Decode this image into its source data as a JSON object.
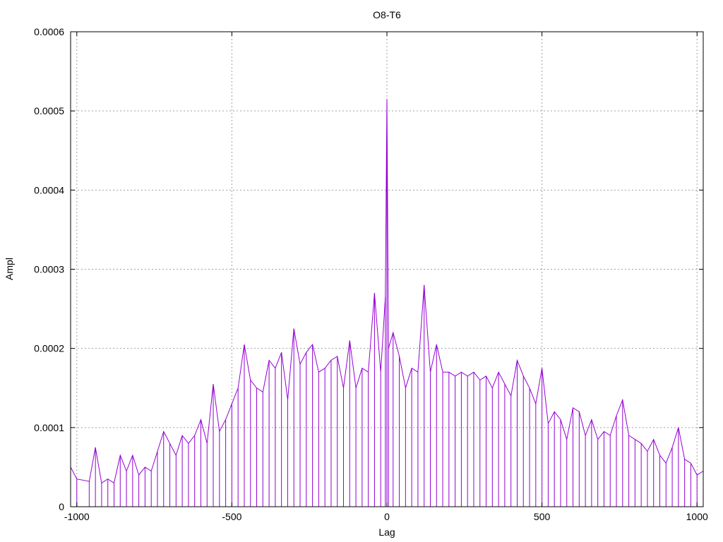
{
  "chart_data": {
    "type": "line",
    "title": "O8-T6",
    "xlabel": "Lag",
    "ylabel": "Ampl",
    "xlim": [
      -1020,
      1020
    ],
    "ylim": [
      0,
      0.0006
    ],
    "xticks": [
      -1000,
      -500,
      0,
      500,
      1000
    ],
    "xtick_labels": [
      "-1000",
      "-500",
      "0",
      "500",
      "1000"
    ],
    "yticks": [
      0,
      0.0001,
      0.0002,
      0.0003,
      0.0004,
      0.0005,
      0.0006
    ],
    "ytick_labels": [
      "0",
      "0.0001",
      "0.0002",
      "0.0003",
      "0.0004",
      "0.0005",
      "0.0006"
    ],
    "grid": true,
    "legend": "none",
    "series": [
      {
        "color": "#9400d3",
        "x": [
          -1020,
          -1000,
          -960,
          -940,
          -920,
          -900,
          -880,
          -860,
          -840,
          -820,
          -800,
          -780,
          -760,
          -740,
          -720,
          -700,
          -680,
          -660,
          -640,
          -620,
          -600,
          -580,
          -560,
          -540,
          -520,
          -500,
          -480,
          -460,
          -440,
          -420,
          -400,
          -380,
          -360,
          -340,
          -320,
          -300,
          -280,
          -260,
          -240,
          -220,
          -200,
          -180,
          -160,
          -140,
          -120,
          -100,
          -80,
          -60,
          -40,
          -20,
          -5,
          0,
          5,
          20,
          40,
          60,
          80,
          100,
          120,
          140,
          160,
          180,
          200,
          220,
          240,
          260,
          280,
          300,
          320,
          340,
          360,
          380,
          400,
          420,
          440,
          460,
          480,
          500,
          520,
          540,
          560,
          580,
          600,
          620,
          640,
          660,
          680,
          700,
          720,
          740,
          760,
          780,
          800,
          820,
          840,
          860,
          880,
          900,
          920,
          940,
          960,
          980,
          1000,
          1020
        ],
        "values": [
          5e-05,
          3.5e-05,
          3.2e-05,
          7.5e-05,
          3e-05,
          3.5e-05,
          3e-05,
          6.5e-05,
          4.5e-05,
          6.5e-05,
          4e-05,
          5e-05,
          4.5e-05,
          7e-05,
          9.5e-05,
          8e-05,
          6.5e-05,
          9e-05,
          8e-05,
          9e-05,
          0.00011,
          8e-05,
          0.000155,
          9.5e-05,
          0.00011,
          0.00013,
          0.00015,
          0.000205,
          0.00016,
          0.00015,
          0.000145,
          0.000185,
          0.000175,
          0.000195,
          0.000135,
          0.000225,
          0.00018,
          0.000195,
          0.000205,
          0.00017,
          0.000175,
          0.000185,
          0.00019,
          0.00015,
          0.00021,
          0.00015,
          0.000175,
          0.00017,
          0.00027,
          0.00017,
          0.000265,
          0.000515,
          0.0002,
          0.00022,
          0.00019,
          0.00015,
          0.000175,
          0.00017,
          0.00028,
          0.00017,
          0.000205,
          0.00017,
          0.00017,
          0.000165,
          0.00017,
          0.000165,
          0.00017,
          0.00016,
          0.000165,
          0.00015,
          0.00017,
          0.000155,
          0.00014,
          0.000185,
          0.000165,
          0.00015,
          0.00013,
          0.000175,
          0.000105,
          0.00012,
          0.00011,
          8.5e-05,
          0.000125,
          0.00012,
          9e-05,
          0.00011,
          8.5e-05,
          9.5e-05,
          9e-05,
          0.000115,
          0.000135,
          9e-05,
          8.5e-05,
          8e-05,
          7e-05,
          8.5e-05,
          6.5e-05,
          5.5e-05,
          7.5e-05,
          0.0001,
          6e-05,
          5.5e-05,
          4e-05,
          4.5e-05
        ]
      }
    ]
  }
}
